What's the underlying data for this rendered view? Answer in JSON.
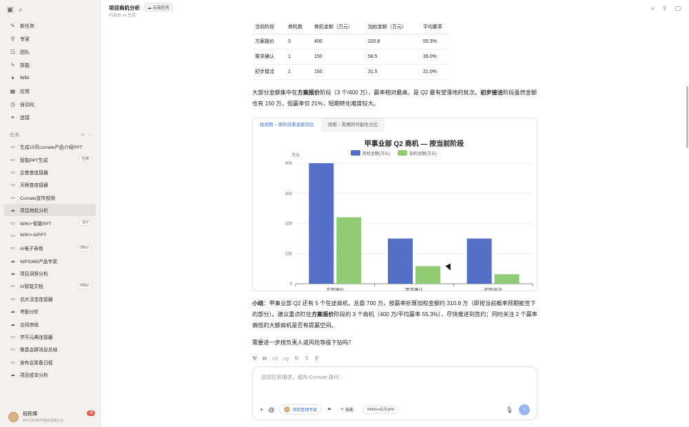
{
  "header": {
    "title": "项目商机分析",
    "tag": "云端任务",
    "subtitle": "内容由 AI 生成"
  },
  "sidebar": {
    "nav": [
      {
        "label": "新任务",
        "icon": "edit-icon"
      },
      {
        "label": "专家",
        "icon": "pin-icon"
      },
      {
        "label": "团队",
        "icon": "team-icon"
      },
      {
        "label": "技能",
        "icon": "bolt-icon"
      },
      {
        "label": "Wiki",
        "icon": "wiki-icon"
      },
      {
        "label": "应用",
        "icon": "apps-icon"
      },
      {
        "label": "自动化",
        "icon": "clock-icon"
      },
      {
        "label": "连接",
        "icon": "link-icon"
      }
    ],
    "tasks_header": "任务",
    "tasks": [
      {
        "label": "生成15页comate产品介绍PPT",
        "icon": "monitor-icon",
        "badge": ""
      },
      {
        "label": "智能PPT生成",
        "icon": "monitor-icon",
        "badge": "应用"
      },
      {
        "label": "企查查连接器",
        "icon": "monitor-icon",
        "badge": ""
      },
      {
        "label": "天眼查连接器",
        "icon": "monitor-icon",
        "badge": ""
      },
      {
        "label": "Comate宣传视频",
        "icon": "monitor-icon",
        "badge": ""
      },
      {
        "label": "项目商机分析",
        "icon": "cloud-icon",
        "badge": ""
      },
      {
        "label": "WIKI+智能PPT",
        "icon": "monitor-icon",
        "badge": "设计"
      },
      {
        "label": "WIKI+AIPPT",
        "icon": "monitor-icon",
        "badge": ""
      },
      {
        "label": "AI电子表格",
        "icon": "monitor-icon",
        "badge": "Office"
      },
      {
        "label": "WPS365产品专家",
        "icon": "cloud-icon",
        "badge": ""
      },
      {
        "label": "项目洞察分析",
        "icon": "cloud-icon",
        "badge": ""
      },
      {
        "label": "AI智能文档",
        "icon": "monitor-icon",
        "badge": "Office"
      },
      {
        "label": "北大法宝连接器",
        "icon": "monitor-icon",
        "badge": ""
      },
      {
        "label": "考勤分析",
        "icon": "cloud-icon",
        "badge": ""
      },
      {
        "label": "合同审核",
        "icon": "cloud-icon",
        "badge": ""
      },
      {
        "label": "学平元典连接器",
        "icon": "monitor-icon",
        "badge": ""
      },
      {
        "label": "推委会群消息总结",
        "icon": "monitor-icon",
        "badge": ""
      },
      {
        "label": "发布会筹备日程",
        "icon": "monitor-icon",
        "badge": ""
      },
      {
        "label": "项目成本分析",
        "icon": "cloud-icon",
        "badge": ""
      }
    ],
    "user": {
      "name": "祝知博",
      "subtitle": "WPS365高升级完成需企业",
      "notifications": "28"
    }
  },
  "table": {
    "headers": [
      "当前阶段",
      "商机数",
      "商机金额（万元）",
      "加权金额（万元）",
      "平均赢率"
    ],
    "rows": [
      [
        "方案报价",
        "3",
        "400",
        "220.8",
        "55.3%"
      ],
      [
        "需求确认",
        "1",
        "150",
        "58.5",
        "39.0%"
      ],
      [
        "初步接洽",
        "1",
        "150",
        "31.5",
        "21.0%"
      ]
    ]
  },
  "summary1": {
    "t1": "大部分金额集中在",
    "b1": "方案报价",
    "t2": "阶段（3 个/400 万），赢率相对最高，是 Q2 最有望落地的批次。",
    "b2": "初步接洽",
    "t3": "阶段虽然金额也有 150 万，但赢率仅 21%，短期转化难度较大。"
  },
  "chart_tabs": [
    "柱状图 – 按阶段看金额对比",
    "饼图 – 看赛的可能性占比"
  ],
  "chart_data": {
    "type": "bar",
    "title": "甲事业部 Q2 商机 — 按当前阶段",
    "ylabel": "万元",
    "categories": [
      "方案报价",
      "需求确认",
      "初步接洽"
    ],
    "series": [
      {
        "name": "商机金额(万元)",
        "values": [
          400,
          150,
          150
        ],
        "color": "#5470c6"
      },
      {
        "name": "加权金额(万元)",
        "values": [
          220.8,
          58.5,
          31.5
        ],
        "color": "#91cc75"
      }
    ],
    "ylim": [
      0,
      400
    ],
    "yticks": [
      0,
      100,
      200,
      300,
      400
    ],
    "legend": "top-center",
    "grid": true
  },
  "summary2": {
    "b1": "小结",
    "t1": "：甲事业部 Q2 还有 5 个在途商机、总盘 700 万，按赢率折算加权金额约 310.8 万（即按当前概率预期能签下的部分）。建议重点盯住",
    "b2": "方案报价",
    "t2": "阶段的 3 个商机（400 万/平均赢率 55.3%），尽快推进到签约；同时关注 2 个赢率偏低的大额商机是否有提赢空间。"
  },
  "question": "需要进一步按负责人或风险等级下钻吗？",
  "input": {
    "placeholder": "追加任务描述，或向 Comate 提问...",
    "expert_label": "项目管理专家",
    "skill_label": "技能",
    "model_label": "mimo-v2.5-pro"
  }
}
